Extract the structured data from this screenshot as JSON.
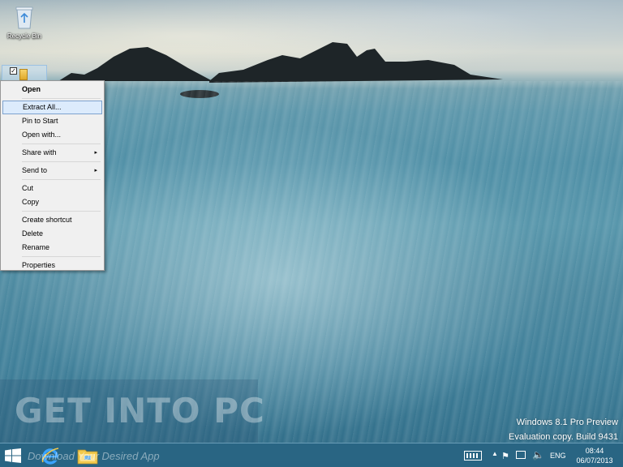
{
  "desktop": {
    "recycle_bin_label": "Recycle Bin"
  },
  "context_menu": {
    "items": [
      {
        "label": "Open",
        "bold": true
      },
      {
        "label": "Extract All...",
        "highlight": true
      },
      {
        "label": "Pin to Start"
      },
      {
        "label": "Open with..."
      },
      {
        "label": "Share with",
        "submenu": true
      },
      {
        "label": "Send to",
        "submenu": true
      },
      {
        "label": "Cut"
      },
      {
        "label": "Copy"
      },
      {
        "label": "Create shortcut"
      },
      {
        "label": "Delete"
      },
      {
        "label": "Rename"
      },
      {
        "label": "Properties"
      }
    ],
    "submenu_arrow": "▸"
  },
  "watermark": {
    "title": "GET INTO PC",
    "subtitle": "Download Your Desired App"
  },
  "evaluation": {
    "line1": "Windows 8.1 Pro Preview",
    "line2": "Evaluation copy. Build 9431"
  },
  "taskbar": {
    "language": "ENG",
    "time": "08:44",
    "date": "06/07/2013",
    "tray_up": "▲",
    "flag_icon": "⚑",
    "volume_icon": "🔈"
  },
  "colors": {
    "taskbar": "#28648a",
    "menu_highlight": "#dcebfc",
    "menu_background": "#f0f0f0"
  }
}
